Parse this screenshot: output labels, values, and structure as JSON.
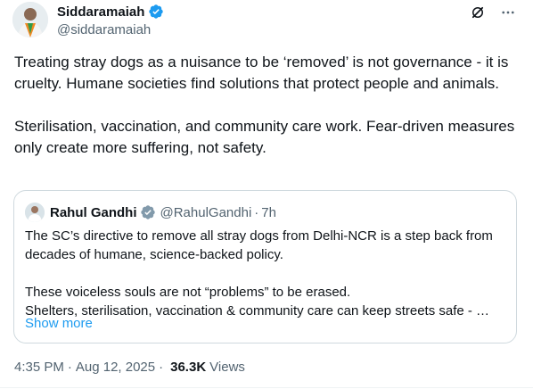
{
  "author": {
    "name": "Siddaramaiah",
    "handle": "@siddaramaiah",
    "verified": true
  },
  "tweet": {
    "text": "Treating stray dogs as a nuisance to be ‘removed’ is not governance - it is cruelty. Humane societies find solutions that protect people and animals.\n\nSterilisation, vaccination, and community care work. Fear-driven measures only create more suffering, not safety."
  },
  "quoted": {
    "name": "Rahul Gandhi",
    "handle": "@RahulGandhi",
    "separator": "·",
    "time": "7h",
    "verified_badge": "gray",
    "text": "The SC’s directive to remove all stray dogs from Delhi-NCR is a step back from decades of humane, science-backed policy.\n\nThese voiceless souls are not “problems” to be erased.\nShelters, sterilisation, vaccination & community care can keep streets safe - …",
    "show_more": "Show more"
  },
  "meta": {
    "time": "4:35 PM",
    "separator": "·",
    "date": "Aug 12, 2025",
    "views_count": "36.3K",
    "views_label": "Views"
  },
  "colors": {
    "text": "#0f1419",
    "secondary": "#536471",
    "link": "#1d9bf0",
    "verified_blue": "#1d9bf0",
    "verified_gray": "#829aab",
    "border": "#cfd9de"
  },
  "icons": {
    "header_actions": [
      "grok-icon",
      "more-icon"
    ]
  }
}
